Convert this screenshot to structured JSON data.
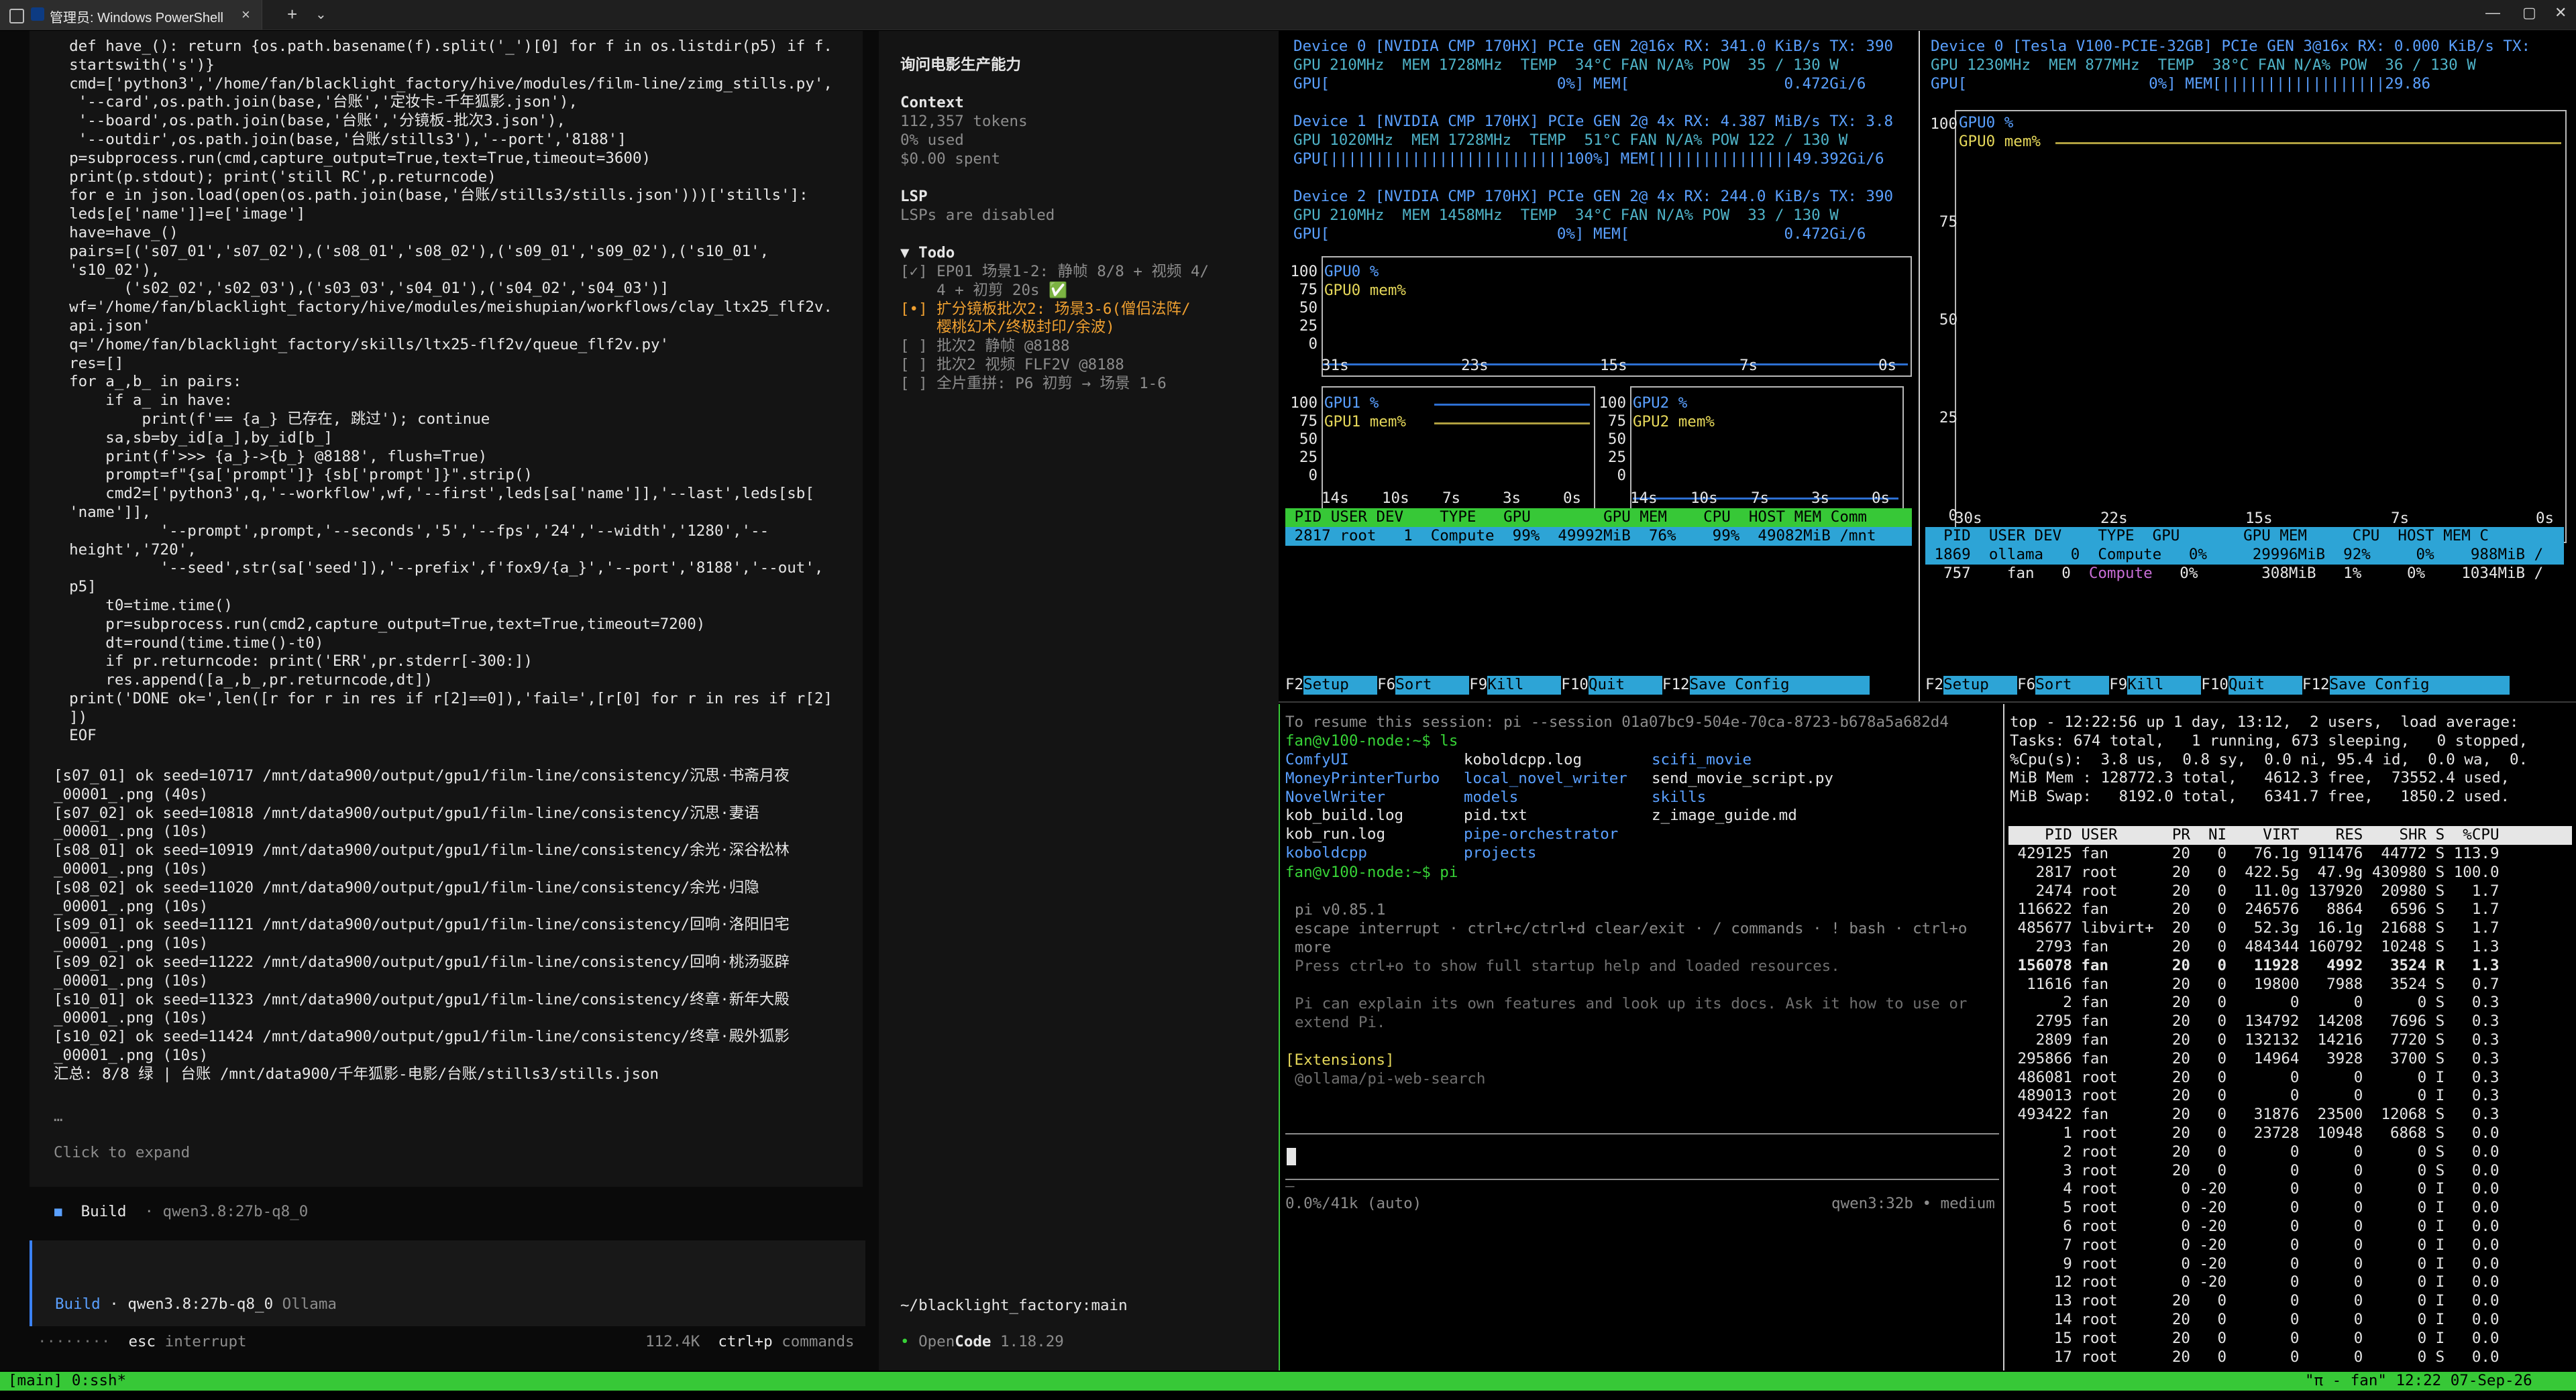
{
  "window": {
    "tab_title": "管理员: Windows PowerShell",
    "close": "×",
    "newtab": "+",
    "dropdown": "⌄",
    "minimize": "—",
    "maximize": "▢",
    "winclose": "✕"
  },
  "left": {
    "code": [
      "  def have_(): return {os.path.basename(f).split('_')[0] for f in os.listdir(p5) if f.",
      "  startswith('s')}",
      "  cmd=['python3','/home/fan/blacklight_factory/hive/modules/film-line/zimg_stills.py',",
      "   '--card',os.path.join(base,'台账','定妆卡-千年狐影.json'),",
      "   '--board',os.path.join(base,'台账','分镜板-批次3.json'),",
      "   '--outdir',os.path.join(base,'台账/stills3'),'--port','8188']",
      "  p=subprocess.run(cmd,capture_output=True,text=True,timeout=3600)",
      "  print(p.stdout); print('still RC',p.returncode)",
      "  for e in json.load(open(os.path.join(base,'台账/stills3/stills.json')))['stills']:",
      "  leds[e['name']]=e['image']",
      "  have=have_()",
      "  pairs=[('s07_01','s07_02'),('s08_01','s08_02'),('s09_01','s09_02'),('s10_01',",
      "  's10_02'),",
      "        ('s02_02','s02_03'),('s03_03','s04_01'),('s04_02','s04_03')]",
      "  wf='/home/fan/blacklight_factory/hive/modules/meishupian/workflows/clay_ltx25_flf2v.",
      "  api.json'",
      "  q='/home/fan/blacklight_factory/skills/ltx25-flf2v/queue_flf2v.py'",
      "  res=[]",
      "  for a_,b_ in pairs:",
      "      if a_ in have:",
      "          print(f'== {a_} 已存在, 跳过'); continue",
      "      sa,sb=by_id[a_],by_id[b_]",
      "      print(f'>>> {a_}->{b_} @8188', flush=True)",
      "      prompt=f\"{sa['prompt']} {sb['prompt']}\".strip()",
      "      cmd2=['python3',q,'--workflow',wf,'--first',leds[sa['name']],'--last',leds[sb[",
      "  'name']],",
      "            '--prompt',prompt,'--seconds','5','--fps','24','--width','1280','--",
      "  height','720',",
      "            '--seed',str(sa['seed']),'--prefix',f'fox9/{a_}','--port','8188','--out',",
      "  p5]",
      "      t0=time.time()",
      "      pr=subprocess.run(cmd2,capture_output=True,text=True,timeout=7200)",
      "      dt=round(time.time()-t0)",
      "      if pr.returncode: print('ERR',pr.stderr[-300:])",
      "      res.append([a_,b_,pr.returncode,dt])",
      "  print('DONE ok=',len([r for r in res if r[2]==0]),'fail=',[r[0] for r in res if r[2]",
      "  ])",
      "  EOF"
    ],
    "results": [
      "[s07_01] ok seed=10717 /mnt/data900/output/gpu1/film-line/consistency/沉思·书斋月夜",
      "_00001_.png (40s)",
      "[s07_02] ok seed=10818 /mnt/data900/output/gpu1/film-line/consistency/沉思·妻语",
      "_00001_.png (10s)",
      "[s08_01] ok seed=10919 /mnt/data900/output/gpu1/film-line/consistency/余光·深谷松林",
      "_00001_.png (10s)",
      "[s08_02] ok seed=11020 /mnt/data900/output/gpu1/film-line/consistency/余光·归隐",
      "_00001_.png (10s)",
      "[s09_01] ok seed=11121 /mnt/data900/output/gpu1/film-line/consistency/回响·洛阳旧宅",
      "_00001_.png (10s)",
      "[s09_02] ok seed=11222 /mnt/data900/output/gpu1/film-line/consistency/回响·桃汤驱辟",
      "_00001_.png (10s)",
      "[s10_01] ok seed=11323 /mnt/data900/output/gpu1/film-line/consistency/终章·新年大殿",
      "_00001_.png (10s)",
      "[s10_02] ok seed=11424 /mnt/data900/output/gpu1/film-line/consistency/终章·殿外狐影",
      "_00001_.png (10s)",
      "汇总: 8/8 绿 | 台账 /mnt/data900/千年狐影-电影/台账/stills3/stills.json"
    ],
    "ellipsis": "…",
    "expand": "Click to expand",
    "build_mark": "◼",
    "build_label": "Build",
    "build_model": "· qwen3.8:27b-q8_0",
    "input_build": "Build",
    "input_model": "· qwen3.8:27b-q8_0",
    "input_provider": "Ollama",
    "status_dots": "········",
    "esc": "esc",
    "interrupt": "interrupt",
    "tokens": "112.4K",
    "ctrlp": "ctrl+p",
    "commands": "commands"
  },
  "sidebar": {
    "title": "询问电影生产能力",
    "context_label": "Context",
    "tokens": "112,357 tokens",
    "used": "0% used",
    "spent": "$0.00 spent",
    "lsp_label": "LSP",
    "lsp_status": "LSPs are disabled",
    "todo_label": "▼ Todo",
    "todos": [
      {
        "text": "[✓] EP01 场景1-2: 静帧 8/8 + 视频 4/",
        "cls": "g"
      },
      {
        "text": "    4 + 初剪 20s ✅",
        "cls": "g"
      },
      {
        "text": "[•] 扩分镜板批次2: 场景3-6(僧侣法阵/",
        "cls": "orange"
      },
      {
        "text": "    樱桃幻术/终极封印/余波)",
        "cls": "orange"
      },
      {
        "text": "[ ] 批次2 静帧 @8188",
        "cls": "g"
      },
      {
        "text": "[ ] 批次2 视频 FLF2V @8188",
        "cls": "g"
      },
      {
        "text": "[ ] 全片重拼: P6 初剪 → 场景 1-6",
        "cls": "g"
      }
    ],
    "path": "~/blacklight_factory:main",
    "opencode_dot": "•",
    "open": "Open",
    "code": "Code",
    "version": "1.18.29"
  },
  "nvtop1": {
    "dev0": [
      "Device 0 [NVIDIA CMP 170HX] PCIe GEN 2@16x RX: 341.0 KiB/s TX: 390",
      "GPU 210MHz  MEM 1728MHz  TEMP  34°C FAN N/A% POW  35 / 130 W",
      "GPU[                         0%] MEM[                 0.472Gi/6"
    ],
    "dev1": [
      "Device 1 [NVIDIA CMP 170HX] PCIe GEN 2@ 4x RX: 4.387 MiB/s TX: 3.8",
      "GPU 1020MHz  MEM 1728MHz  TEMP  51°C FAN N/A% POW 122 / 130 W",
      "GPU[||||||||||||||||||||||||||100%] MEM[|||||||||||||||49.392Gi/6"
    ],
    "dev2": [
      "Device 2 [NVIDIA CMP 170HX] PCIe GEN 2@ 4x RX: 244.0 KiB/s TX: 390",
      "GPU 210MHz  MEM 1458MHz  TEMP  34°C FAN N/A% POW  33 / 130 W",
      "GPU[                         0%] MEM[                 0.472Gi/6"
    ],
    "chart0_labels": [
      "GPU0 %",
      "GPU0 mem%"
    ],
    "chart1_labels": [
      "GPU1 %",
      "GPU1 mem%"
    ],
    "chart2_labels": [
      "GPU2 %",
      "GPU2 mem%"
    ],
    "yticks": [
      "100",
      "75",
      "50",
      "25",
      "0"
    ],
    "xticks_big": [
      "31s",
      "23s",
      "15s",
      "7s",
      "0s"
    ],
    "xticks_small": [
      "14s",
      "10s",
      "7s",
      "3s",
      "0s"
    ],
    "proc_header": " PID USER DEV    TYPE   GPU        GPU MEM    CPU  HOST MEM Comm",
    "proc_row": " 2817 root   1  Compute  99%  49992MiB  76%    99%  49082MiB /mnt",
    "keys": [
      [
        "F2",
        "Setup"
      ],
      [
        "F6",
        "Sort"
      ],
      [
        "F9",
        "Kill"
      ],
      [
        "F10",
        "Quit"
      ],
      [
        "F12",
        "Save Config"
      ]
    ]
  },
  "nvtop2": {
    "dev0": [
      "Device 0 [Tesla V100-PCIE-32GB] PCIe GEN 3@16x RX: 0.000 KiB/s TX:",
      "GPU 1230MHz  MEM 877MHz  TEMP  38°C FAN N/A% POW  36 / 130 W",
      "GPU[                    0%] MEM[||||||||||||||||||29.86"
    ],
    "chart_labels": [
      "GPU0 %",
      "GPU0 mem%"
    ],
    "yticks": [
      "100",
      "75",
      "50",
      "25",
      "0"
    ],
    "xticks": [
      "30s",
      "22s",
      "15s",
      "7s",
      "0s"
    ],
    "proc_header": "  PID  USER DEV    TYPE  GPU       GPU MEM     CPU  HOST MEM C",
    "rows": [
      {
        "pid": " 1869",
        "user": "ollama",
        "dev": "0",
        "type": "Compute",
        "gpu": "0%",
        "mem": "29996MiB  92%",
        "cpu": "0%",
        "host": "988MiB /",
        "sel": true
      },
      {
        "pid": "  757",
        "user": "  fan",
        "dev": "0",
        "type": "Compute",
        "gpu": "0%",
        "mem": "  308MiB   1%",
        "cpu": "0%",
        "host": "1034MiB /",
        "sel": false
      }
    ],
    "keys": [
      [
        "F2",
        "Setup"
      ],
      [
        "F6",
        "Sort"
      ],
      [
        "F9",
        "Kill"
      ],
      [
        "F10",
        "Quit"
      ],
      [
        "F12",
        "Save Config"
      ]
    ]
  },
  "pi": {
    "resume": "To resume this session: pi --session 01a07bc9-504e-70ca-8723-b678a5a682d4",
    "prompt1": "fan@v100-node:~$ ls",
    "ls_cols": [
      [
        "ComfyUI",
        "MoneyPrinterTurbo",
        "NovelWriter",
        "kob_build.log",
        "kob_run.log",
        "koboldcpp"
      ],
      [
        "koboldcpp.log",
        "local_novel_writer",
        "models",
        "pid.txt",
        "pipe-orchestrator",
        "projects"
      ],
      [
        "scifi_movie",
        "send_movie_script.py",
        "skills",
        "z_image_guide.md",
        "",
        ""
      ]
    ],
    "ls_dirs": [
      [
        "ComfyUI",
        "MoneyPrinterTurbo",
        "NovelWriter",
        "koboldcpp"
      ],
      [
        "local_novel_writer",
        "models",
        "pipe-orchestrator",
        "projects"
      ],
      [
        "scifi_movie",
        "skills"
      ]
    ],
    "prompt2": "fan@v100-node:~$ pi",
    "version": "pi v0.85.1",
    "keys1": "escape interrupt · ctrl+c/ctrl+d clear/exit · / commands · ! bash · ctrl+o",
    "keys2": "more",
    "help": "Press ctrl+o to show full startup help and loaded resources.",
    "explain1": "Pi can explain its own features and look up its docs. Ask it how to use or",
    "explain2": "extend Pi.",
    "ext_label": "[Extensions]",
    "ext_item": "@ollama/pi-web-search",
    "foot_left": "0.0%/41k (auto)",
    "foot_right": "qwen3:32b • medium",
    "foot_dots": "—"
  },
  "top": {
    "header": [
      "top - 12:22:56 up 1 day, 13:12,  2 users,  load average:",
      "Tasks: 674 total,   1 running, 673 sleeping,   0 stopped,",
      "%Cpu(s):  3.8 us,  0.8 sy,  0.0 ni, 95.4 id,  0.0 wa,  0.",
      "MiB Mem : 128772.3 total,   4612.3 free,  73552.4 used,",
      "MiB Swap:   8192.0 total,   6341.7 free,   1850.2 used."
    ],
    "col_header": "    PID USER      PR  NI    VIRT    RES    SHR S  %CPU",
    "rows": [
      [
        " 429125 fan       20   0   76.1g 911476  44772 S 113.9",
        false
      ],
      [
        "   2817 root      20   0  422.5g  47.9g 430980 S 100.0",
        false
      ],
      [
        "   2474 root      20   0   11.0g 137920  20980 S   1.7",
        false
      ],
      [
        " 116622 fan       20   0  246576   8864   6596 S   1.7",
        false
      ],
      [
        " 485677 libvirt+  20   0   52.3g  16.1g  21688 S   1.7",
        false
      ],
      [
        "   2793 fan       20   0  484344 160792  10248 S   1.3",
        false
      ],
      [
        " 156078 fan       20   0   11928   4992   3524 R   1.3",
        true
      ],
      [
        "  11616 fan       20   0   19800   7988   3524 S   0.7",
        false
      ],
      [
        "      2 fan       20   0       0      0      0 S   0.3",
        false
      ],
      [
        "   2795 fan       20   0  134792  14208   7696 S   0.3",
        false
      ],
      [
        "   2809 fan       20   0  132132  14216   7720 S   0.3",
        false
      ],
      [
        " 295866 fan       20   0   14964   3928   3700 S   0.3",
        false
      ],
      [
        " 486081 root      20   0       0      0      0 I   0.3",
        false
      ],
      [
        " 489013 root      20   0       0      0      0 I   0.3",
        false
      ],
      [
        " 493422 fan       20   0   31876  23500  12068 S   0.3",
        false
      ],
      [
        "      1 root      20   0   23728  10948   6868 S   0.0",
        false
      ],
      [
        "      2 root      20   0       0      0      0 S   0.0",
        false
      ],
      [
        "      3 root      20   0       0      0      0 S   0.0",
        false
      ],
      [
        "      4 root       0 -20       0      0      0 I   0.0",
        false
      ],
      [
        "      5 root       0 -20       0      0      0 I   0.0",
        false
      ],
      [
        "      6 root       0 -20       0      0      0 I   0.0",
        false
      ],
      [
        "      7 root       0 -20       0      0      0 I   0.0",
        false
      ],
      [
        "      9 root       0 -20       0      0      0 I   0.0",
        false
      ],
      [
        "     12 root       0 -20       0      0      0 I   0.0",
        false
      ],
      [
        "     13 root      20   0       0      0      0 I   0.0",
        false
      ],
      [
        "     14 root      20   0       0      0      0 I   0.0",
        false
      ],
      [
        "     15 root      20   0       0      0      0 I   0.0",
        false
      ],
      [
        "     17 root      20   0       0      0      0 S   0.0",
        false
      ]
    ]
  },
  "tmux": {
    "left": "[main] 0:ssh*",
    "right": "\"π - fan\" 12:22 07-Sep-26"
  }
}
